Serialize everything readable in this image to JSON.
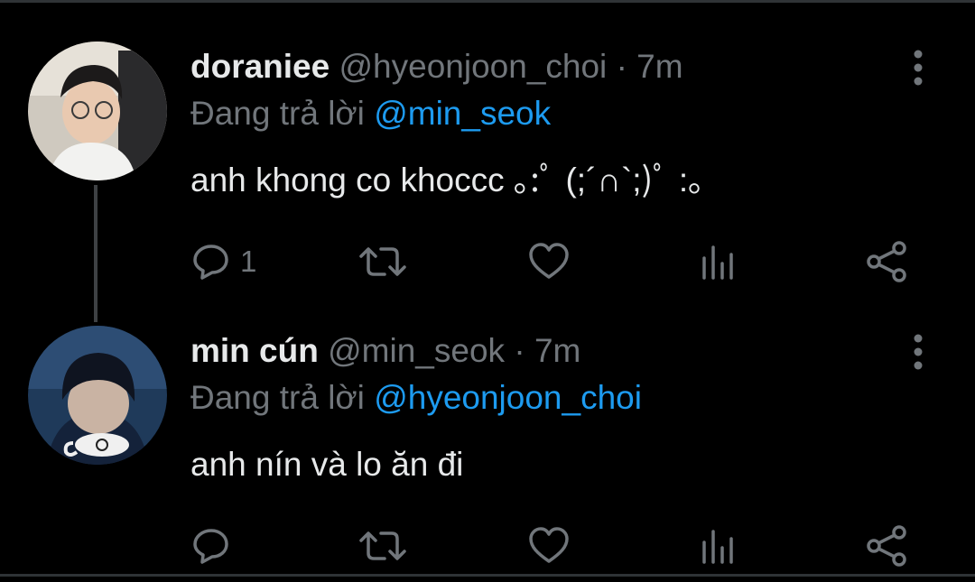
{
  "tweets": [
    {
      "display_name": "doraniee",
      "handle": "@hyeonjoon_choi",
      "separator": "·",
      "time": "7m",
      "reply_prefix": "Đang trả lời ",
      "reply_to": "@min_seok",
      "text": "anh khong co khoccc ｡:ﾟ (;´∩`;)ﾟ :｡",
      "reply_count": "1",
      "retweet_count": "",
      "like_count": ""
    },
    {
      "display_name": "min cún",
      "handle": "@min_seok",
      "separator": "·",
      "time": "7m",
      "reply_prefix": "Đang trả lời ",
      "reply_to": "@hyeonjoon_choi",
      "text": "anh nín và lo ăn đi",
      "reply_count": "",
      "retweet_count": "",
      "like_count": ""
    }
  ],
  "colors": {
    "background": "#000000",
    "text_primary": "#e7e9ea",
    "text_secondary": "#71767b",
    "mention": "#1d9bf0",
    "divider": "#2f3336"
  },
  "icons": {
    "more": "more-vertical-icon",
    "reply": "reply-bubble-icon",
    "retweet": "retweet-icon",
    "like": "heart-icon",
    "views": "views-bar-chart-icon",
    "share": "share-icon"
  }
}
